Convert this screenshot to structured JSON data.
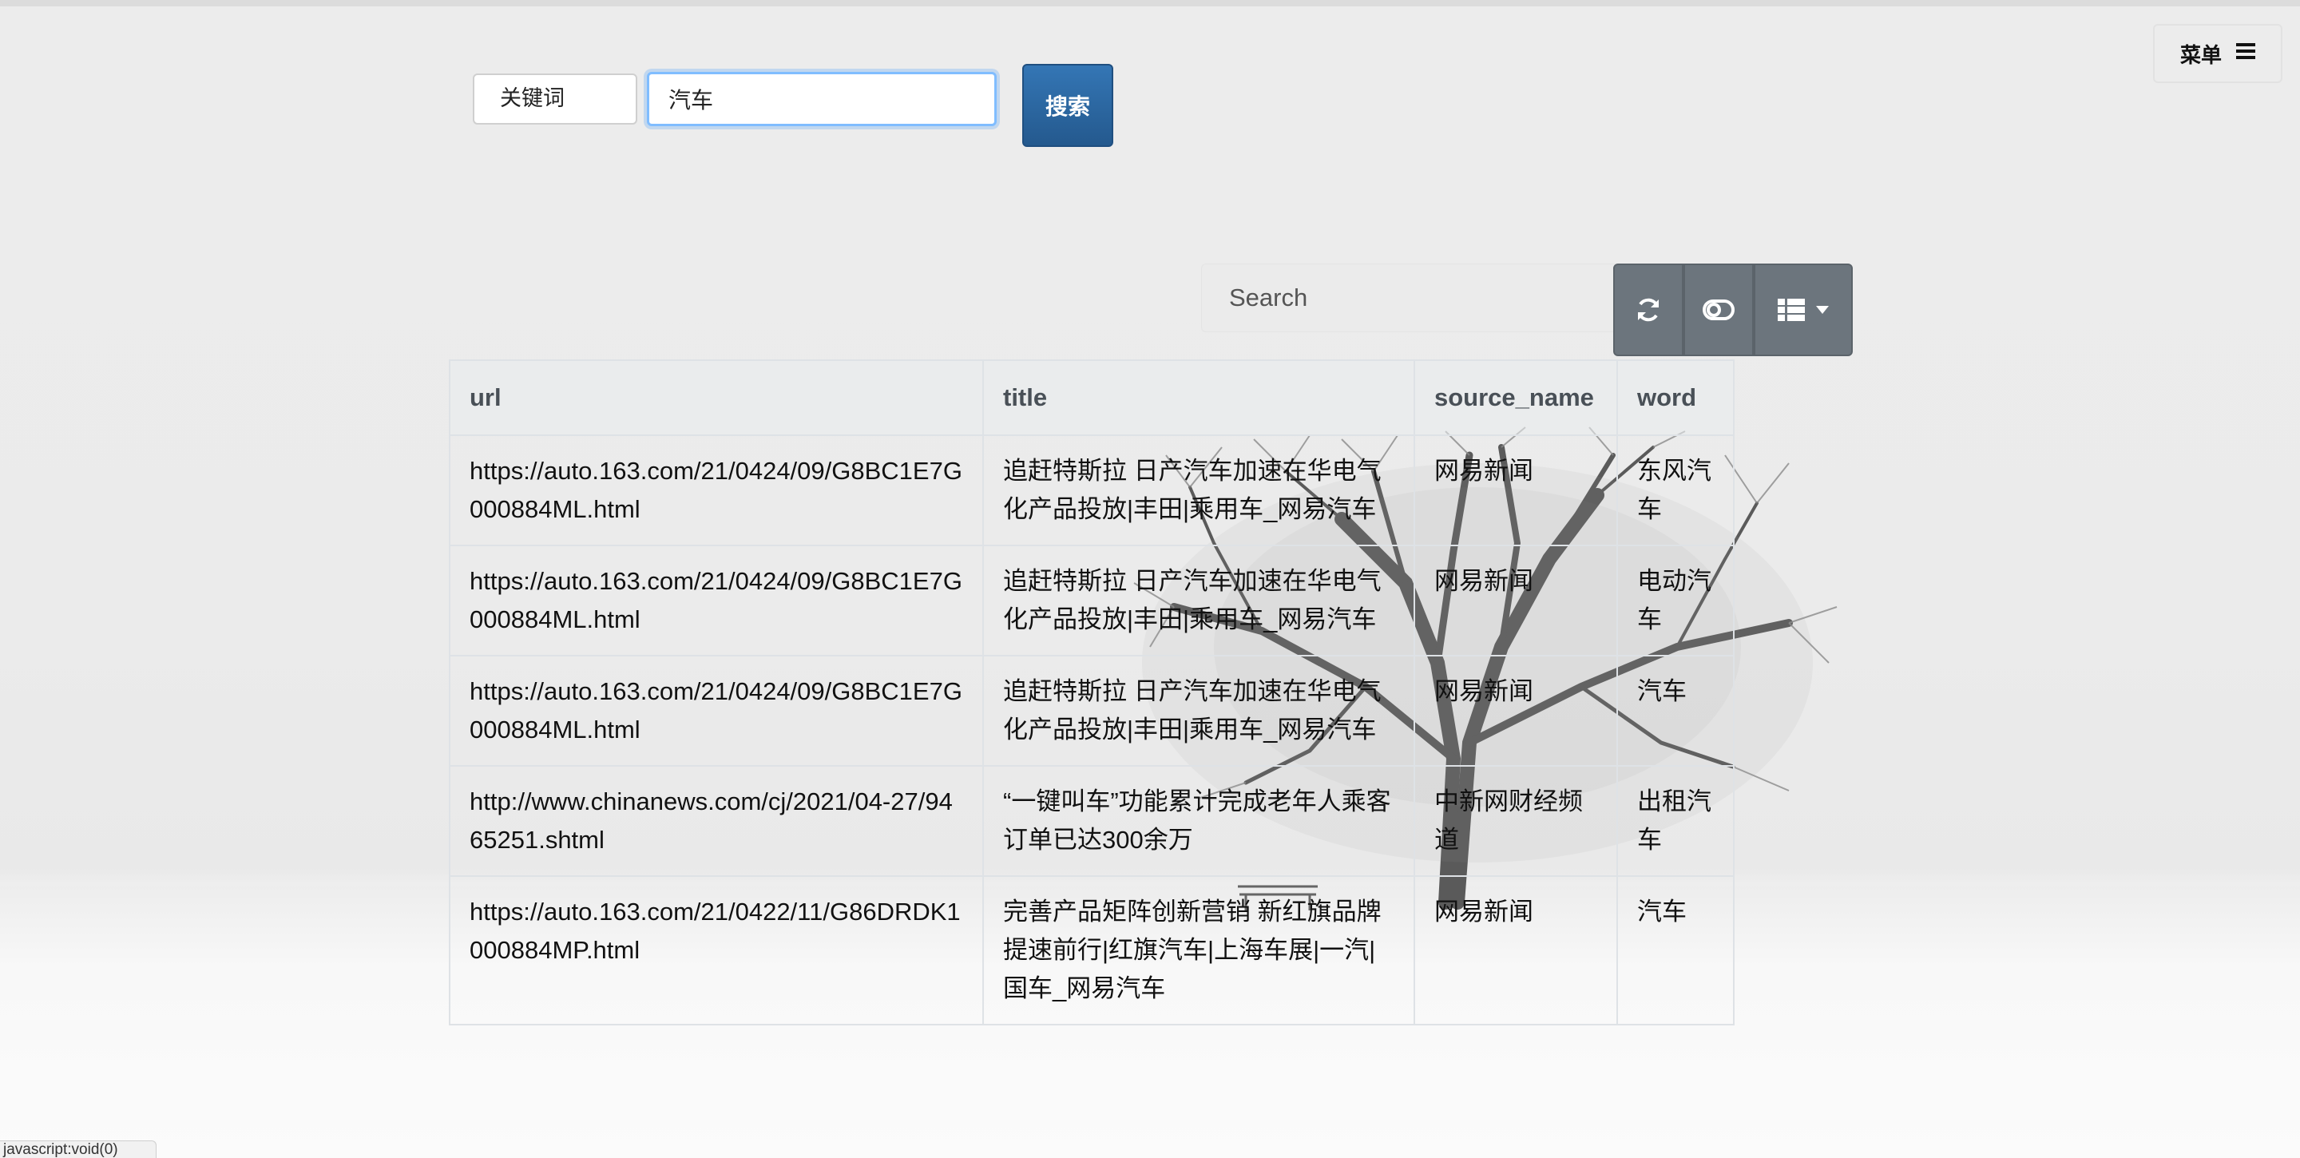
{
  "search": {
    "field_select": "关键词",
    "keyword_value": "汽车",
    "button_label": "搜索"
  },
  "menu": {
    "label": "菜单"
  },
  "table_toolbar": {
    "search_placeholder": "Search",
    "refresh_icon": "refresh-icon",
    "toggle_icon": "toggle-view-icon",
    "columns_icon": "columns-list-icon"
  },
  "table": {
    "headers": [
      "url",
      "title",
      "source_name",
      "word"
    ],
    "rows": [
      {
        "url": "https://auto.163.com/21/0424/09/G8BC1E7G000884ML.html",
        "title": "追赶特斯拉 日产汽车加速在华电气化产品投放|丰田|乘用车_网易汽车",
        "source_name": "网易新闻",
        "word": "东风汽车"
      },
      {
        "url": "https://auto.163.com/21/0424/09/G8BC1E7G000884ML.html",
        "title": "追赶特斯拉 日产汽车加速在华电气化产品投放|丰田|乘用车_网易汽车",
        "source_name": "网易新闻",
        "word": "电动汽车"
      },
      {
        "url": "https://auto.163.com/21/0424/09/G8BC1E7G000884ML.html",
        "title": "追赶特斯拉 日产汽车加速在华电气化产品投放|丰田|乘用车_网易汽车",
        "source_name": "网易新闻",
        "word": "汽车"
      },
      {
        "url": "http://www.chinanews.com/cj/2021/04-27/9465251.shtml",
        "title": "“一键叫车”功能累计完成老年人乘客订单已达300余万",
        "source_name": "中新网财经频道",
        "word": "出租汽车"
      },
      {
        "url": "https://auto.163.com/21/0422/11/G86DRDK1000884MP.html",
        "title": "完善产品矩阵创新营销 新红旗品牌提速前行|红旗汽车|上海车展|一汽|国车_网易汽车",
        "source_name": "网易新闻",
        "word": "汽车"
      }
    ]
  },
  "status_bar": {
    "text": "javascript:void(0)"
  }
}
